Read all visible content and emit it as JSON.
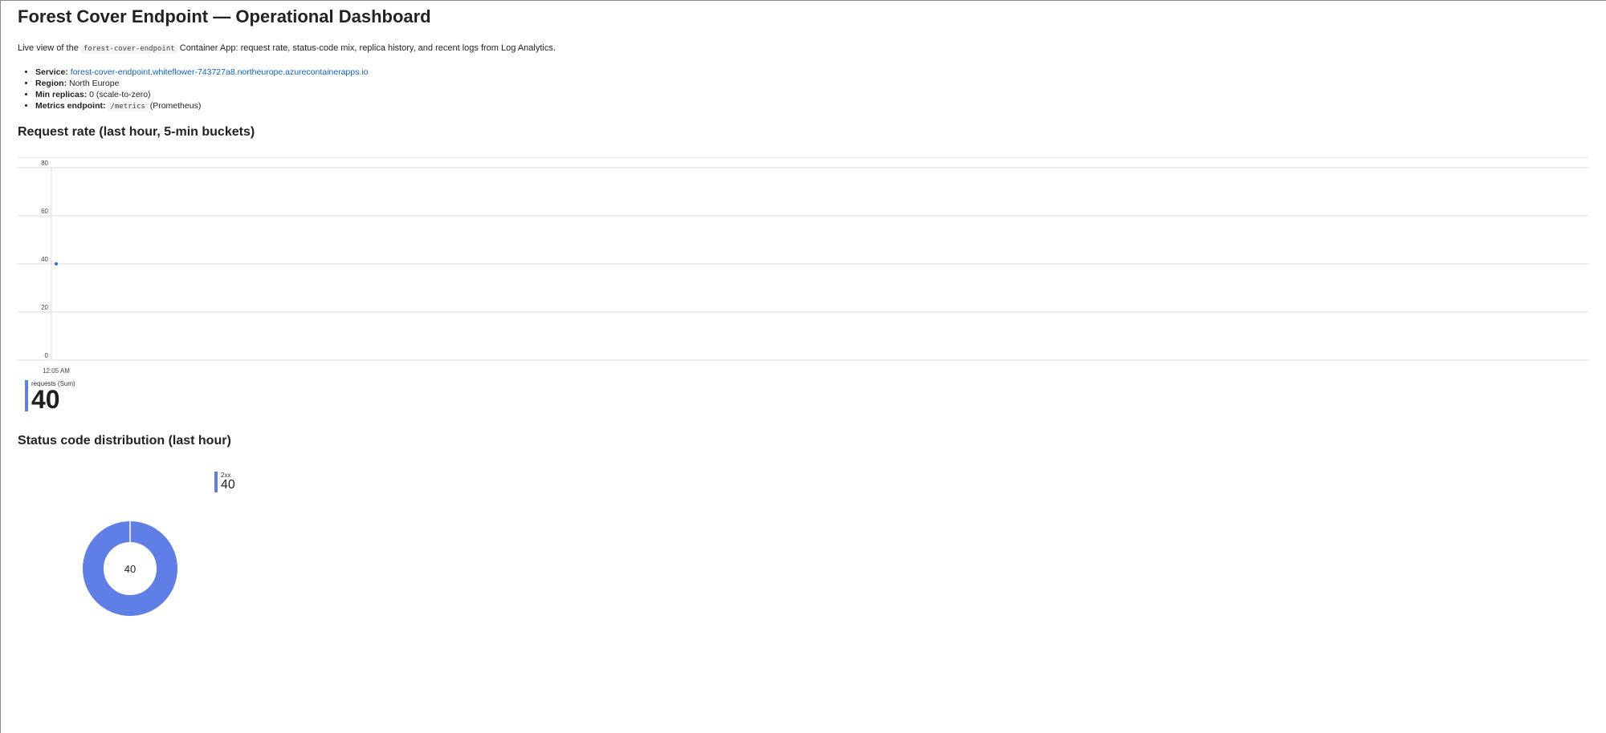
{
  "page": {
    "title": "Forest Cover Endpoint — Operational Dashboard",
    "intro_prefix": "Live view of the",
    "intro_code": "forest-cover-endpoint",
    "intro_suffix": "Container App: request rate, status-code mix, replica history, and recent logs from Log Analytics."
  },
  "details": {
    "service_label": "Service:",
    "service_value": "forest-cover-endpoint.whiteflower-743727a8.northeurope.azurecontainerapps.io",
    "region_label": "Region:",
    "region_value": "North Europe",
    "replicas_label": "Min replicas:",
    "replicas_value": "0 (scale-to-zero)",
    "metrics_label": "Metrics endpoint:",
    "metrics_code": "/metrics",
    "metrics_suffix": "(Prometheus)"
  },
  "sections": {
    "request_rate": "Request rate (last hour, 5-min buckets)",
    "status_codes": "Status code distribution (last hour)"
  },
  "tiles": {
    "requests_label": "requests (Sum)",
    "requests_value": "40",
    "status_label": "2xx",
    "status_value": "40"
  },
  "colors": {
    "accent": "#5f7ee6",
    "series": "#1a73e8",
    "link": "#0b63c4"
  },
  "chart_data": [
    {
      "type": "line",
      "title": "",
      "xlabel": "",
      "ylabel": "",
      "ylim": [
        0,
        80
      ],
      "yticks": [
        0,
        20,
        40,
        60,
        80
      ],
      "x_tick_labels": [
        "12:05 AM"
      ],
      "grid": true,
      "series": [
        {
          "name": "requests (Sum)",
          "x": [
            "12:05 AM"
          ],
          "values": [
            40
          ]
        }
      ]
    },
    {
      "type": "pie",
      "title": "",
      "center_label": "40",
      "categories": [
        "2xx"
      ],
      "values": [
        40
      ]
    }
  ]
}
